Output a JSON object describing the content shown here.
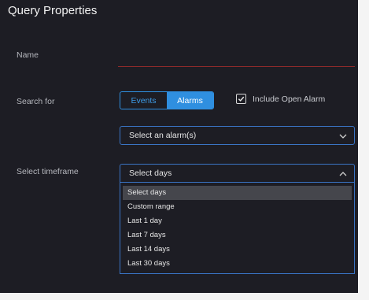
{
  "panel": {
    "title": "Query Properties"
  },
  "name_field": {
    "label": "Name",
    "value": ""
  },
  "search_for": {
    "label": "Search for",
    "options": [
      "Events",
      "Alarms"
    ],
    "selected": "Alarms",
    "include_open_alarm": {
      "label": "Include Open Alarm",
      "checked": true
    }
  },
  "alarm_select": {
    "value": "Select an alarm(s)"
  },
  "timeframe": {
    "label": "Select timeframe",
    "value": "Select days",
    "expanded": true,
    "options": [
      "Select days",
      "Custom range",
      "Last 1 day",
      "Last 7 days",
      "Last 14 days",
      "Last 30 days"
    ]
  },
  "colors": {
    "panel_bg": "#1d1d24",
    "accent": "#2f8fe0",
    "select_border": "#3a74c4",
    "name_underline": "#8e2a2a",
    "highlight": "#45464c"
  },
  "icons": [
    "check-icon",
    "chevron-down-icon",
    "chevron-up-icon"
  ]
}
